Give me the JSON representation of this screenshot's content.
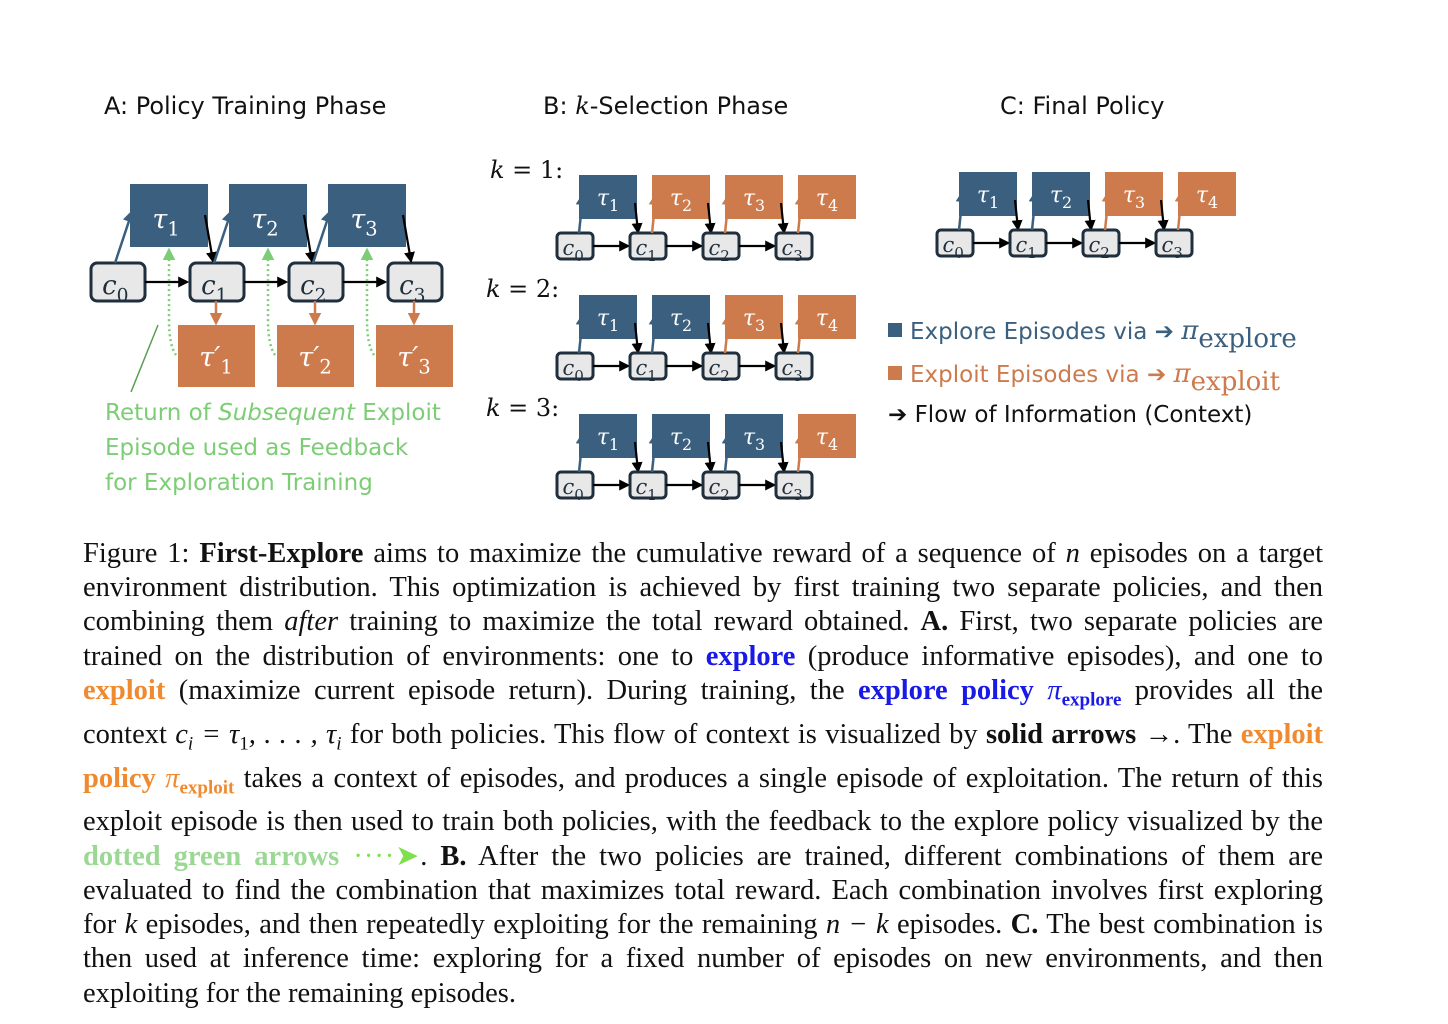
{
  "panels": {
    "a": {
      "title": "A: Policy Training Phase",
      "explore_episodes": [
        "τ",
        "τ",
        "τ"
      ],
      "explore_subscripts": [
        "1",
        "2",
        "3"
      ],
      "exploit_episodes": [
        "τ′",
        "τ′",
        "τ′"
      ],
      "exploit_subscripts": [
        "1",
        "2",
        "3"
      ],
      "contexts": [
        "c",
        "c",
        "c",
        "c"
      ],
      "context_subscripts": [
        "0",
        "1",
        "2",
        "3"
      ],
      "note": {
        "line1_prefix": "Return of ",
        "line1_italic": "Subsequent",
        "line1_suffix": " Exploit",
        "line2": "Episode used as Feedback",
        "line3": "for Exploration Training"
      }
    },
    "b": {
      "title_prefix": "B: ",
      "title_var": "k",
      "title_suffix": "-Selection Phase",
      "rows": [
        {
          "label_var": "k",
          "label_rest": " = 1:",
          "k": 1
        },
        {
          "label_var": "k",
          "label_rest": " = 2:",
          "k": 2
        },
        {
          "label_var": "k",
          "label_rest": " = 3:",
          "k": 3
        }
      ]
    },
    "c": {
      "title": "C: Final Policy",
      "k": 2
    }
  },
  "episodes_per_sequence": 4,
  "legend": {
    "explore": {
      "text": "Explore Episodes via ➔ ",
      "pi": "π",
      "sub": "explore",
      "color": "#3b5f7e"
    },
    "exploit": {
      "text": "Exploit Episodes via ➔ ",
      "pi": "π",
      "sub": "exploit",
      "color": "#cd7b4c"
    },
    "flow": {
      "text": "➔ Flow of Information (Context)",
      "color": "#111111"
    }
  },
  "colors": {
    "explore": "#3b5f7e",
    "exploit": "#cd7b4c",
    "context_fill": "#e8e8e8",
    "feedback_green": "#7ccd75",
    "caption_blue": "#1a1ae6",
    "caption_orange": "#f08a30"
  },
  "caption": {
    "fig": "Figure 1: ",
    "name": "First-Explore",
    "t1": " aims to maximize the cumulative reward of a sequence of ",
    "n": "n",
    "t2": " episodes on a target environment distribution. This optimization is achieved by first training two separate policies, and then combining them ",
    "after": "after",
    "t3": " training to maximize the total reward obtained. ",
    "A": "A.",
    "t4": " First, two separate policies are trained on the distribution of environments: one to ",
    "explore": "explore",
    "t5": " (produce informative episodes), and one to ",
    "exploit": "exploit",
    "t6": " (maximize current episode return). During training, the ",
    "explore_policy": "explore policy",
    "pi": "π",
    "sub_explore": "explore",
    "t7": " provides all the context ",
    "ci": "c",
    "ci_sub": "i",
    "eq": " = τ",
    "eq_sub1": "1",
    "eq_mid": ", . . . , τ",
    "eq_subi": "i",
    "t8": " for both policies. This flow of context is visualized by ",
    "solid": "solid arrows →",
    "t9": ". The ",
    "exploit_policy": "exploit policy",
    "sub_exploit": "exploit",
    "t10": " takes a context of episodes, and produces a single episode of exploitation. The return of this exploit episode is then used to train both policies, with the feedback to the explore policy visualized by the ",
    "dotted": "dotted green arrows",
    "dotted_arrow": " ····➤",
    "t11": ". ",
    "B": "B.",
    "t12": " After the two policies are trained, different combinations of them are evaluated to find the combination that maximizes total reward. Each combination involves first exploring for ",
    "k": "k",
    "t13": " episodes, and then repeatedly exploiting for the remaining ",
    "nk": "n − k",
    "t14": " episodes. ",
    "C": "C.",
    "t15": " The best combination is then used at inference time: exploring for a fixed number of episodes on new environments, and then exploiting for the remaining episodes."
  }
}
